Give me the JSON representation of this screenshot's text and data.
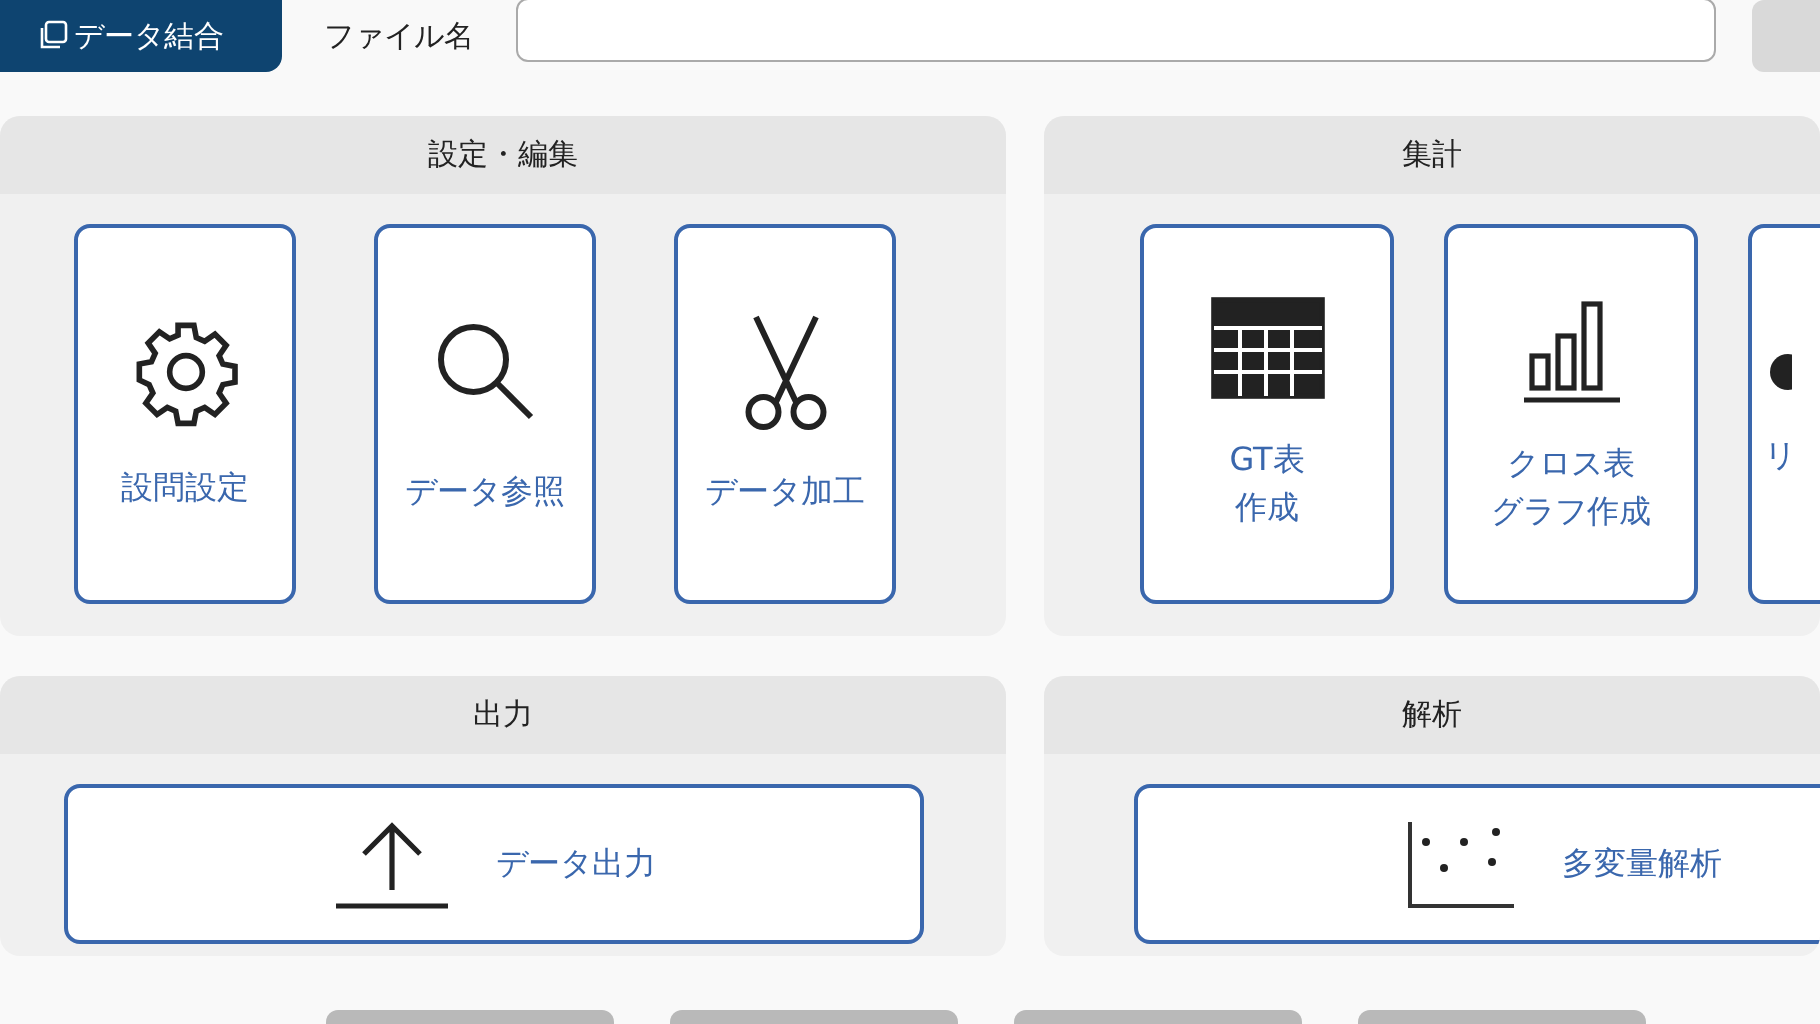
{
  "top_bar": {
    "tabs": [
      {
        "label": "データ結合",
        "selected": true
      }
    ],
    "file_label": "ファイル名"
  },
  "panels": [
    {
      "title": "設定・編集",
      "buttons": [
        {
          "lines": [
            "設問設定"
          ],
          "kind": "gear"
        },
        {
          "lines": [
            "データ参照"
          ],
          "kind": "search"
        },
        {
          "lines": [
            "データ加工"
          ],
          "kind": "scissors"
        }
      ]
    },
    {
      "title": "集計",
      "buttons": [
        {
          "lines": [
            "GT表",
            "作成"
          ],
          "kind": "table"
        },
        {
          "lines": [
            "クロス表",
            "グラフ作成"
          ],
          "kind": "bars"
        },
        {
          "lines": [
            "リ"
          ],
          "kind": "partial"
        }
      ]
    },
    {
      "title": "出力",
      "buttons": [
        {
          "lines": [
            "データ出力"
          ],
          "kind": "upload"
        }
      ]
    },
    {
      "title": "解析",
      "buttons": [
        {
          "lines": [
            "多変量解析"
          ],
          "kind": "scatter"
        }
      ]
    }
  ]
}
